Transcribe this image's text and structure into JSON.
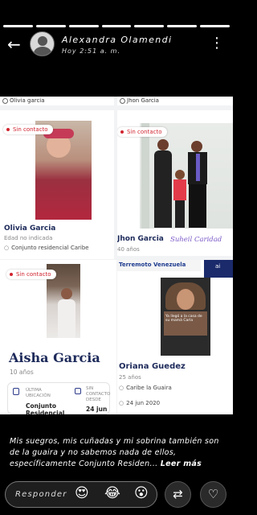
{
  "story": {
    "author": "Alexandra Olamendi",
    "time": "Hoy 2:51 a. m.",
    "progress_segments": 7,
    "progress_done": 7
  },
  "screenshot": {
    "search_left": "Olivia garcia",
    "search_right": "Jhon Garcia",
    "cards": [
      {
        "badge": "Sin contacto",
        "name": "Olivia Garcia",
        "age": "Edad no indicada",
        "location": "Conjunto residencial Caribe"
      },
      {
        "badge": "Sin contacto",
        "name": "Jhon Garcia",
        "age": "40 años",
        "signature": "Suheil Caridad"
      },
      {
        "badge": "Sin contacto",
        "name": "Aisha Garcia",
        "age": "10 años",
        "stat1_label": "ÚLTIMA UBICACIÓN",
        "stat1_value": "Conjunto Residencial",
        "stat2_label": "SIN CONTACTO DESDE",
        "stat2_value": "24 jun"
      },
      {
        "banner": "Terremoto Venezuela",
        "banner_side": "ai",
        "inner_text": "Ya llegó a la casa de su mamá Carla",
        "name": "Oriana Guedez",
        "age": "25 años",
        "location": "Caribe la Guaira",
        "date": "24 jun 2020"
      }
    ]
  },
  "caption": {
    "text": "Mis suegros, mis cuñadas y mi sobrina también son de la guaira y no sabemos nada de ellos, específicamente Conjunto Residen...",
    "more": "Leer más"
  },
  "reply": {
    "placeholder": "Responder",
    "reactions": [
      "😍",
      "😂",
      "😮"
    ]
  }
}
